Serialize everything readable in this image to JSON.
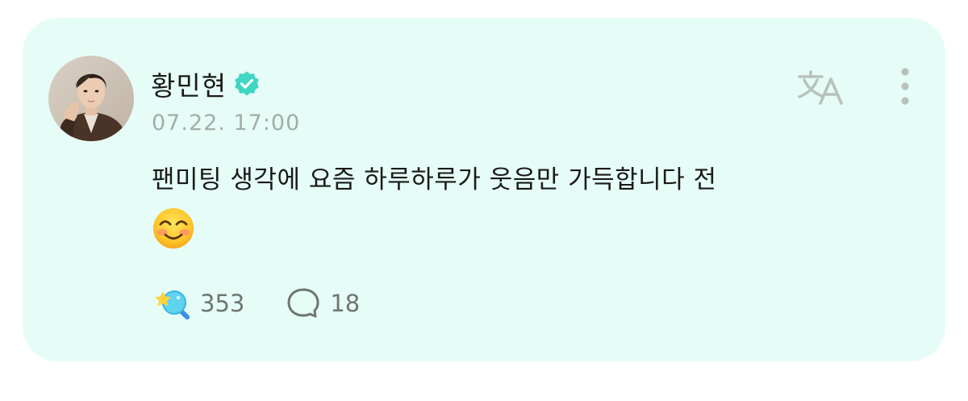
{
  "post": {
    "author": {
      "name": "황민현",
      "verified": true,
      "avatar": "profile-photo"
    },
    "timestamp": "07.22. 17:00",
    "text": "팬미팅 생각에 요즘 하루하루가 웃음만 가득합니다 전",
    "emoji": "smiling-face-with-smiling-eyes",
    "likes": "353",
    "comments": "18",
    "translate_icon": "translate-icon",
    "more_icon": "more-vertical-icon"
  },
  "colors": {
    "card_background": "#e6fcf7",
    "verified_badge": "#3fd6c3",
    "secondary_text": "#a3adaa",
    "icon_gray": "#b7c2bf"
  }
}
